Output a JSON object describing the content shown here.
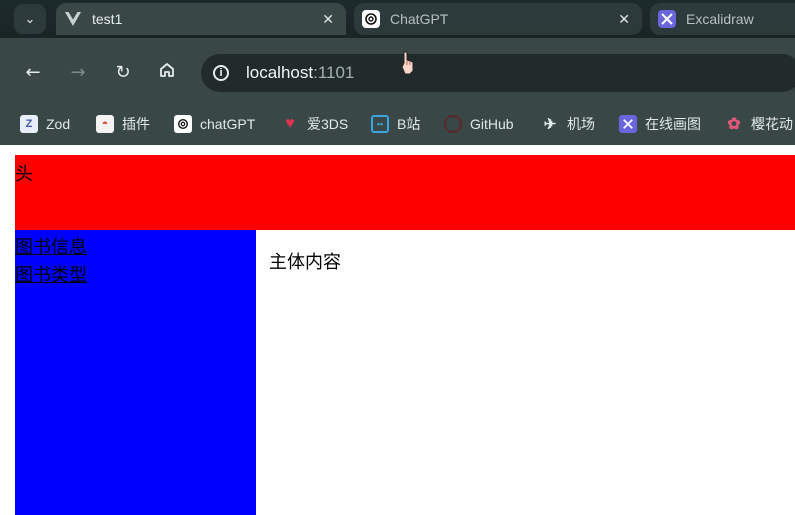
{
  "browser": {
    "tabs": [
      {
        "title": "test1",
        "favicon": "vue-icon",
        "active": true
      },
      {
        "title": "ChatGPT",
        "favicon": "chatgpt-icon",
        "active": false
      },
      {
        "title": "Excalidraw",
        "favicon": "excalidraw-icon",
        "active": false
      }
    ],
    "address": {
      "host": "localhost",
      "port": ":1101"
    },
    "bookmarks": [
      {
        "label": "Zod",
        "icon": "zod-icon"
      },
      {
        "label": "插件",
        "icon": "extension-icon"
      },
      {
        "label": "chatGPT",
        "icon": "chatgpt-icon"
      },
      {
        "label": "爱3DS",
        "icon": "heart-gem-icon"
      },
      {
        "label": "B站",
        "icon": "bilibili-icon"
      },
      {
        "label": "GitHub",
        "icon": "github-icon"
      },
      {
        "label": "机场",
        "icon": "plane-icon"
      },
      {
        "label": "在线画图",
        "icon": "excalidraw-icon"
      },
      {
        "label": "樱花动",
        "icon": "sakura-icon"
      }
    ]
  },
  "page": {
    "header_text": "头",
    "aside_links": [
      {
        "label": "图书信息"
      },
      {
        "label": "图书类型"
      }
    ],
    "main_text": "主体内容",
    "colors": {
      "header": "#ff0000",
      "aside": "#0000ff",
      "main": "#ffffff"
    }
  }
}
